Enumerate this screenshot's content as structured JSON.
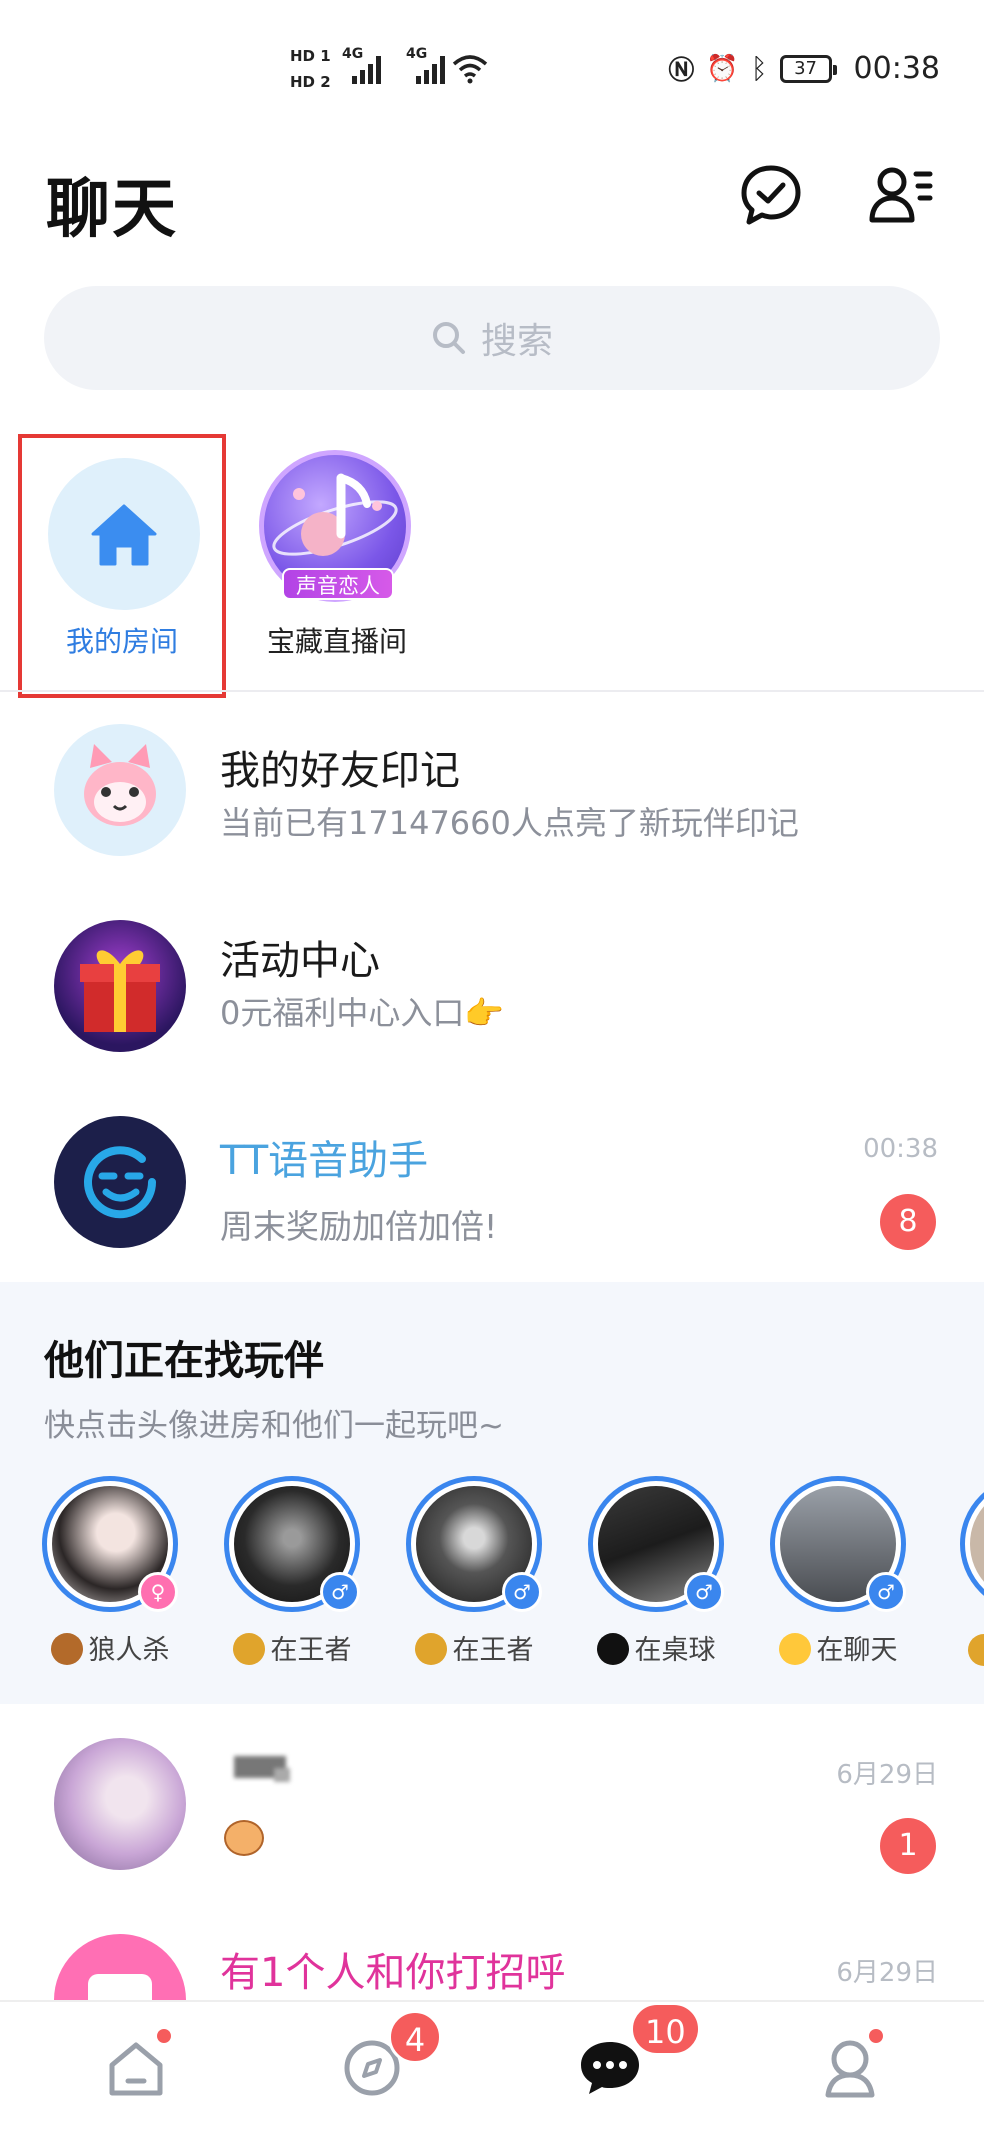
{
  "status_bar": {
    "hd1": "HD 1",
    "hd2": "HD 2",
    "net1": "4G",
    "net2": "4G",
    "battery": "37",
    "time": "00:38"
  },
  "header": {
    "title": "聊天",
    "icons": [
      "chat-check-icon",
      "contacts-icon"
    ]
  },
  "search": {
    "placeholder": "搜索"
  },
  "rooms": {
    "my_room_label": "我的房间",
    "treasure_tag": "声音恋人",
    "treasure_label": "宝藏直播间"
  },
  "conversations": [
    {
      "title": "我的好友印记",
      "subtitle": "当前已有17147660人点亮了新玩伴印记"
    },
    {
      "title": "活动中心",
      "subtitle": "0元福利中心入口👉"
    },
    {
      "title": "TT语音助手",
      "subtitle": "周末奖励加倍加倍!",
      "time": "00:38",
      "badge": "8"
    }
  ],
  "find_partners": {
    "title": "他们正在找玩伴",
    "subtitle": "快点击头像进房和他们一起玩吧~",
    "partners": [
      {
        "status": "狼人杀",
        "gender": "female"
      },
      {
        "status": "在王者",
        "gender": "male"
      },
      {
        "status": "在王者",
        "gender": "male"
      },
      {
        "status": "在桌球",
        "gender": "male"
      },
      {
        "status": "在聊天",
        "gender": "male"
      }
    ]
  },
  "recent": [
    {
      "time": "6月29日",
      "badge": "1"
    },
    {
      "title": "有1个人和你打招呼",
      "time": "6月29日"
    }
  ],
  "tabbar": {
    "discover_badge": "4",
    "chat_badge": "10"
  },
  "colors": {
    "accent_blue": "#3a86ee",
    "badge_red": "#f55c5c",
    "highlight_border": "#e53935",
    "assistant_blue": "#4aa3df",
    "greeting_pink": "#e0339b"
  }
}
